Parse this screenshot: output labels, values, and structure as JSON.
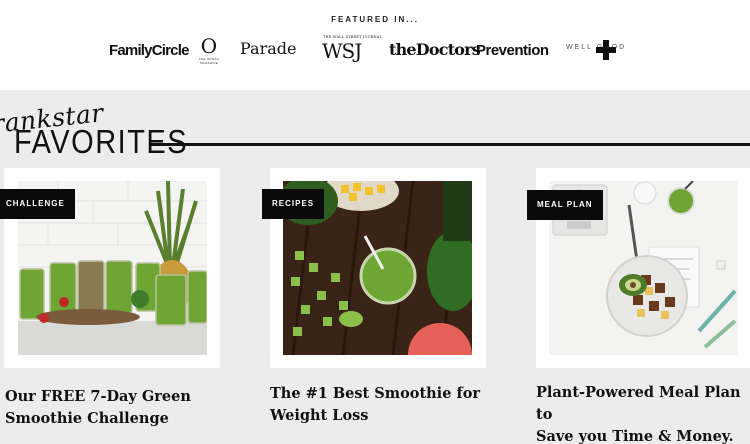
{
  "featured": {
    "label": "FEATURED IN...",
    "logos": {
      "family_circle": "FamilyCircle",
      "o": "O",
      "o_sub": "THE OPRAH MAGAZINE",
      "parade": "Parade",
      "wsj_top": "THE WALL STREET JOURNAL",
      "wsj": "WSJ",
      "doctors": "theDoctors",
      "prevention": "Prevention",
      "wellgood": "WELL      GOOD"
    }
  },
  "section": {
    "script_word": "rankstar",
    "title": "FAVORITES"
  },
  "cards": [
    {
      "tag": "CHALLENGE",
      "title_line1": "Our FREE 7-Day Green",
      "title_line2": "Smoothie Challenge"
    },
    {
      "tag": "RECIPES",
      "title_line1": "The #1 Best Smoothie for",
      "title_line2": "Weight Loss"
    },
    {
      "tag": "MEAL PLAN",
      "title_line1": "Plant-Powered Meal Plan to",
      "title_line2": "Save you Time & Money."
    }
  ],
  "colors": {
    "page_background": "#ececec",
    "tag_background": "#0a0a0a",
    "smoothie_green": "#6fa532",
    "text": "#111111"
  },
  "icons": [
    "plus-cross-icon"
  ]
}
